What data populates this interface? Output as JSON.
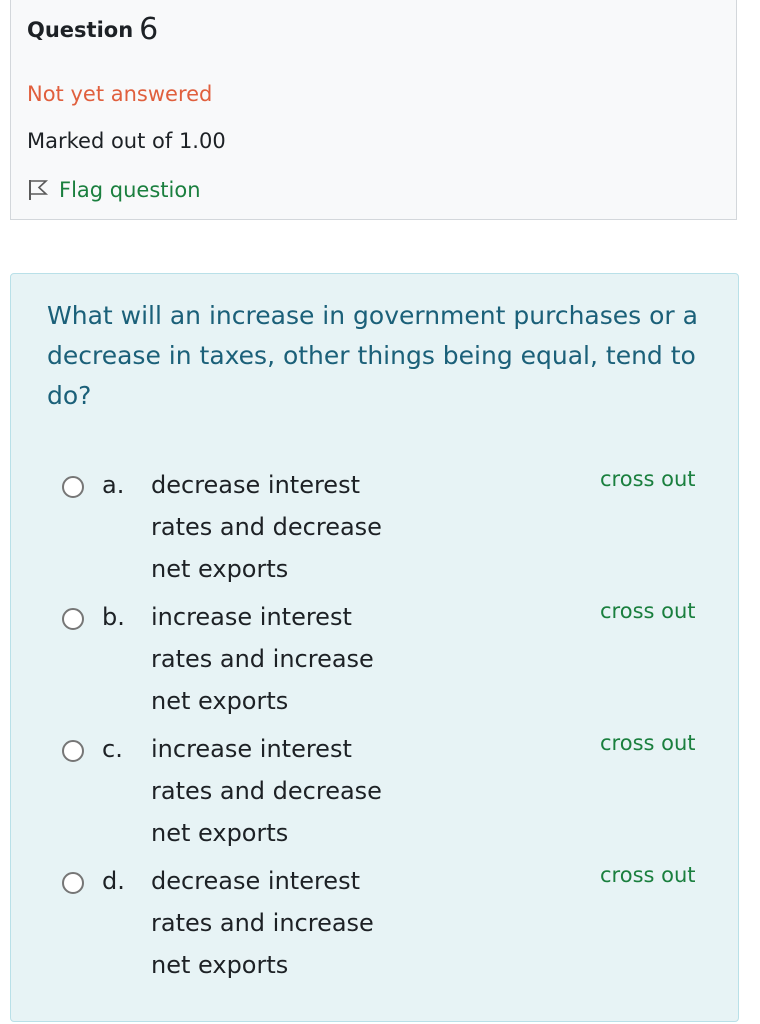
{
  "question_info": {
    "label": "Question",
    "number": "6",
    "state": "Not yet answered",
    "grade": "Marked out of 1.00",
    "flag_label": "Flag question"
  },
  "question": {
    "text": "What will an increase in government purchases or a decrease in taxes, other things being equal, tend to do?"
  },
  "answers": [
    {
      "letter": "a.",
      "text": "decrease interest rates and decrease net exports",
      "cross_out": "cross out"
    },
    {
      "letter": "b.",
      "text": "increase interest rates and increase net exports",
      "cross_out": "cross out"
    },
    {
      "letter": "c.",
      "text": "increase interest rates and decrease net exports",
      "cross_out": "cross out"
    },
    {
      "letter": "d.",
      "text": "decrease interest rates and increase net exports",
      "cross_out": "cross out"
    }
  ],
  "colors": {
    "state": "#e05f3d",
    "link": "#1a7f3e",
    "question_text": "#1b6079",
    "formulation_bg": "#e7f3f5",
    "info_bg": "#f8f9fa"
  },
  "icons": {
    "flag": "flag-outline-icon",
    "radio": "radio-unchecked"
  }
}
